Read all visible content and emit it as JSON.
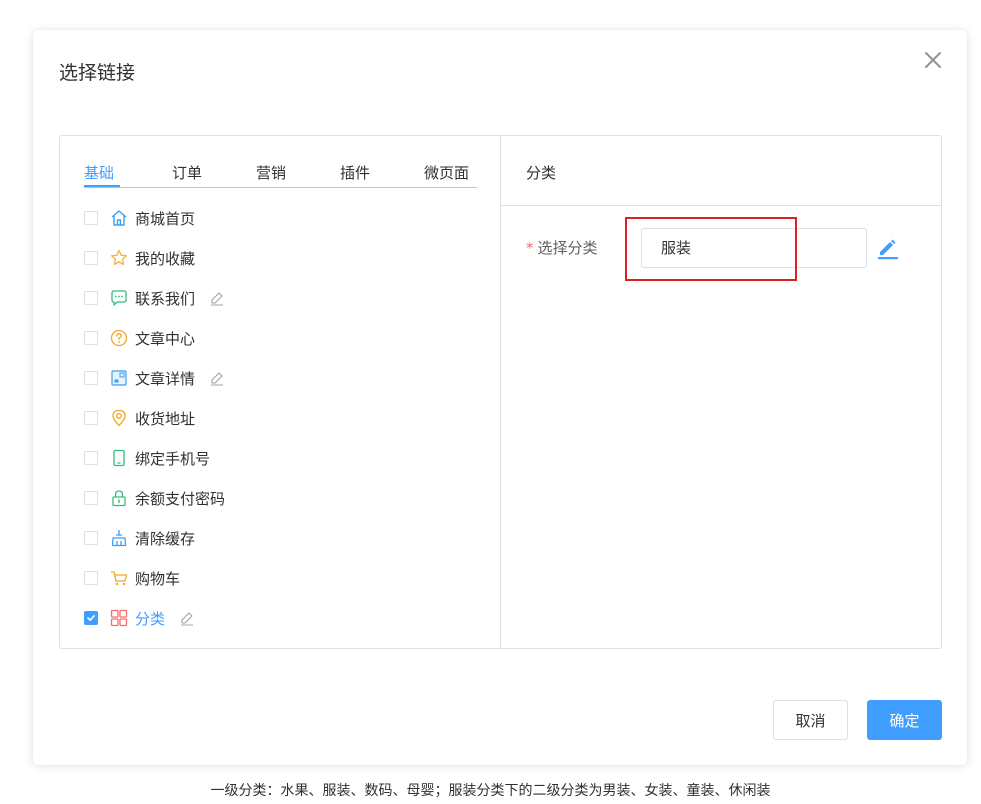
{
  "dialog": {
    "title": "选择链接",
    "tabs": [
      {
        "label": "基础",
        "active": true
      },
      {
        "label": "订单"
      },
      {
        "label": "营销"
      },
      {
        "label": "插件"
      },
      {
        "label": "微页面"
      }
    ],
    "items": [
      {
        "label": "商城首页",
        "icon": "home-icon",
        "checked": false,
        "editable": false
      },
      {
        "label": "我的收藏",
        "icon": "star-icon",
        "checked": false,
        "editable": false
      },
      {
        "label": "联系我们",
        "icon": "chat-icon",
        "checked": false,
        "editable": true
      },
      {
        "label": "文章中心",
        "icon": "question-circle-icon",
        "checked": false,
        "editable": false
      },
      {
        "label": "文章详情",
        "icon": "article-icon",
        "checked": false,
        "editable": true
      },
      {
        "label": "收货地址",
        "icon": "location-icon",
        "checked": false,
        "editable": false
      },
      {
        "label": "绑定手机号",
        "icon": "phone-icon",
        "checked": false,
        "editable": false
      },
      {
        "label": "余额支付密码",
        "icon": "lock-icon",
        "checked": false,
        "editable": false
      },
      {
        "label": "清除缓存",
        "icon": "broom-icon",
        "checked": false,
        "editable": false
      },
      {
        "label": "购物车",
        "icon": "cart-icon",
        "checked": false,
        "editable": false
      },
      {
        "label": "分类",
        "icon": "category-icon",
        "checked": true,
        "editable": true
      }
    ],
    "right_panel": {
      "title": "分类",
      "field_label": "选择分类",
      "required_mark": "*",
      "field_value": "服装"
    },
    "buttons": {
      "cancel": "取消",
      "confirm": "确定"
    }
  },
  "caption": "一级分类：水果、服装、数码、母婴；服装分类下的二级分类为男装、女装、童装、休闲装",
  "colors": {
    "accent": "#409eff",
    "highlight": "#e02020",
    "required": "#f56c6c"
  }
}
